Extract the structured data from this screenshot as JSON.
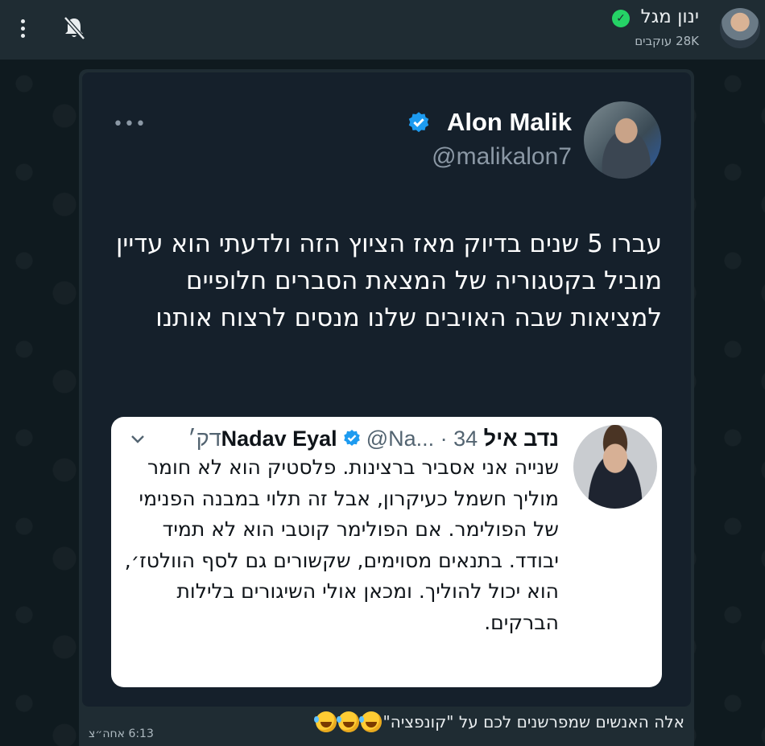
{
  "header": {
    "channel_name": "ינון מגל",
    "followers": "28K עוקבים"
  },
  "tweet": {
    "author_name": "Alon Malik",
    "handle": "@malikalon7",
    "more": "•••",
    "body": "עברו 5 שנים בדיוק מאז הציוץ הזה ולדעתי הוא עדיין מוביל בקטגוריה של המצאת הסברים חלופיים למציאות שבה האויבים שלנו מנסים לרצוח אותנו",
    "quoted": {
      "name": "נדב איל Nadav Eyal",
      "meta": "@Na... · 34דק׳",
      "text": "שנייה אני אסביר ברצינות. פלסטיק הוא לא חומר מוליך חשמל כעיקרון, אבל זה תלוי במבנה הפנימי של הפולימר. אם הפולימר קוטבי הוא לא תמיד יבודד. בתנאים מסוימים, שקשורים גם לסף הוולטז׳, הוא יכול להוליך. ומכאן אולי השיגורים בלילות הברקים."
    }
  },
  "message": {
    "caption": "אלה האנשים שמפרשנים לכם על \"קונפציה\"",
    "timestamp": "6:13 אחה״צ"
  },
  "colors": {
    "header_bg": "#1f2c33",
    "tweet_bg": "#15202b",
    "verified_blue": "#1d9bf0",
    "verified_green": "#25d366"
  },
  "icons": [
    "verified-icon",
    "mute-bell-icon",
    "menu-dots-icon",
    "chevron-down-icon",
    "laughing-emoji-icon"
  ]
}
